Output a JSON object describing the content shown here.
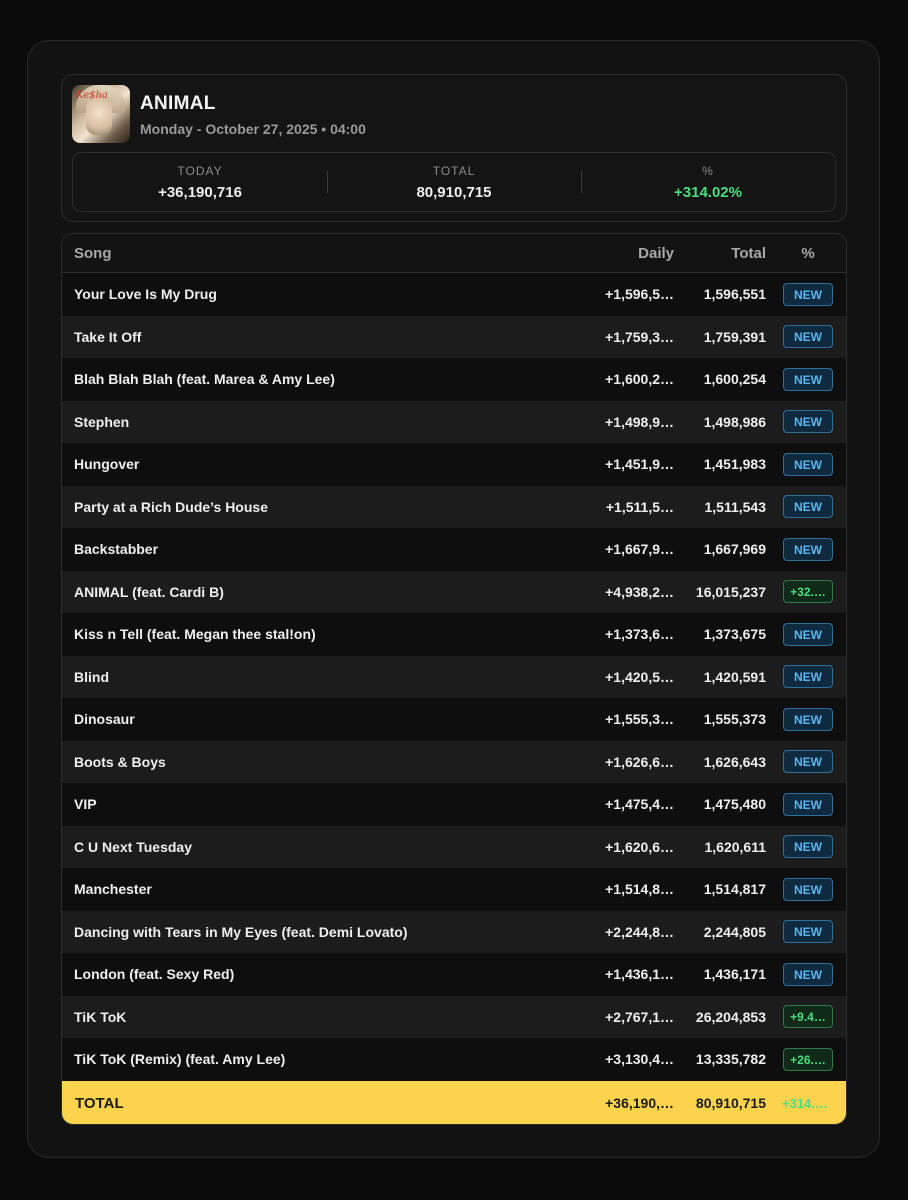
{
  "album": {
    "title": "ANIMAL",
    "date": "Monday - October 27, 2025 • 04:00",
    "cover_signature": "Ke$ha"
  },
  "stats": {
    "today_label": "TODAY",
    "today_value": "+36,190,716",
    "total_label": "TOTAL",
    "total_value": "80,910,715",
    "pct_label": "%",
    "pct_value": "+314.02%"
  },
  "table": {
    "headers": {
      "song": "Song",
      "daily": "Daily",
      "total": "Total",
      "pct": "%"
    },
    "rows": [
      {
        "song": "Your Love Is My Drug",
        "daily": "+1,596,5…",
        "total": "1,596,551",
        "badge": "NEW",
        "badge_type": "new"
      },
      {
        "song": "Take It Off",
        "daily": "+1,759,3…",
        "total": "1,759,391",
        "badge": "NEW",
        "badge_type": "new"
      },
      {
        "song": "Blah Blah Blah (feat. Marea & Amy Lee)",
        "daily": "+1,600,2…",
        "total": "1,600,254",
        "badge": "NEW",
        "badge_type": "new"
      },
      {
        "song": "Stephen",
        "daily": "+1,498,9…",
        "total": "1,498,986",
        "badge": "NEW",
        "badge_type": "new"
      },
      {
        "song": "Hungover",
        "daily": "+1,451,9…",
        "total": "1,451,983",
        "badge": "NEW",
        "badge_type": "new"
      },
      {
        "song": "Party at a Rich Dude’s House",
        "daily": "+1,511,5…",
        "total": "1,511,543",
        "badge": "NEW",
        "badge_type": "new"
      },
      {
        "song": "Backstabber",
        "daily": "+1,667,9…",
        "total": "1,667,969",
        "badge": "NEW",
        "badge_type": "new"
      },
      {
        "song": "ANIMAL (feat. Cardi B)",
        "daily": "+4,938,2…",
        "total": "16,015,237",
        "badge": "+32.…",
        "badge_type": "up"
      },
      {
        "song": "Kiss n Tell (feat. Megan thee stal!on)",
        "daily": "+1,373,6…",
        "total": "1,373,675",
        "badge": "NEW",
        "badge_type": "new"
      },
      {
        "song": "Blind",
        "daily": "+1,420,5…",
        "total": "1,420,591",
        "badge": "NEW",
        "badge_type": "new"
      },
      {
        "song": "Dinosaur",
        "daily": "+1,555,3…",
        "total": "1,555,373",
        "badge": "NEW",
        "badge_type": "new"
      },
      {
        "song": "Boots & Boys",
        "daily": "+1,626,6…",
        "total": "1,626,643",
        "badge": "NEW",
        "badge_type": "new"
      },
      {
        "song": "VIP",
        "daily": "+1,475,4…",
        "total": "1,475,480",
        "badge": "NEW",
        "badge_type": "new"
      },
      {
        "song": "C U Next Tuesday",
        "daily": "+1,620,6…",
        "total": "1,620,611",
        "badge": "NEW",
        "badge_type": "new"
      },
      {
        "song": "Manchester",
        "daily": "+1,514,8…",
        "total": "1,514,817",
        "badge": "NEW",
        "badge_type": "new"
      },
      {
        "song": "Dancing with Tears in My Eyes (feat. Demi Lovato)",
        "daily": "+2,244,8…",
        "total": "2,244,805",
        "badge": "NEW",
        "badge_type": "new"
      },
      {
        "song": "London (feat. Sexy Red)",
        "daily": "+1,436,1…",
        "total": "1,436,171",
        "badge": "NEW",
        "badge_type": "new"
      },
      {
        "song": "TiK ToK",
        "daily": "+2,767,1…",
        "total": "26,204,853",
        "badge": "+9.4…",
        "badge_type": "up"
      },
      {
        "song": "TiK ToK (Remix) (feat. Amy Lee)",
        "daily": "+3,130,4…",
        "total": "13,335,782",
        "badge": "+26.…",
        "badge_type": "up"
      }
    ],
    "total_row": {
      "label": "TOTAL",
      "daily": "+36,190,…",
      "total": "80,910,715",
      "pct": "+314.…"
    }
  },
  "colors": {
    "accent_yellow": "#fbd34d",
    "green": "#4ade80",
    "new_blue": "#5bb6ee"
  }
}
